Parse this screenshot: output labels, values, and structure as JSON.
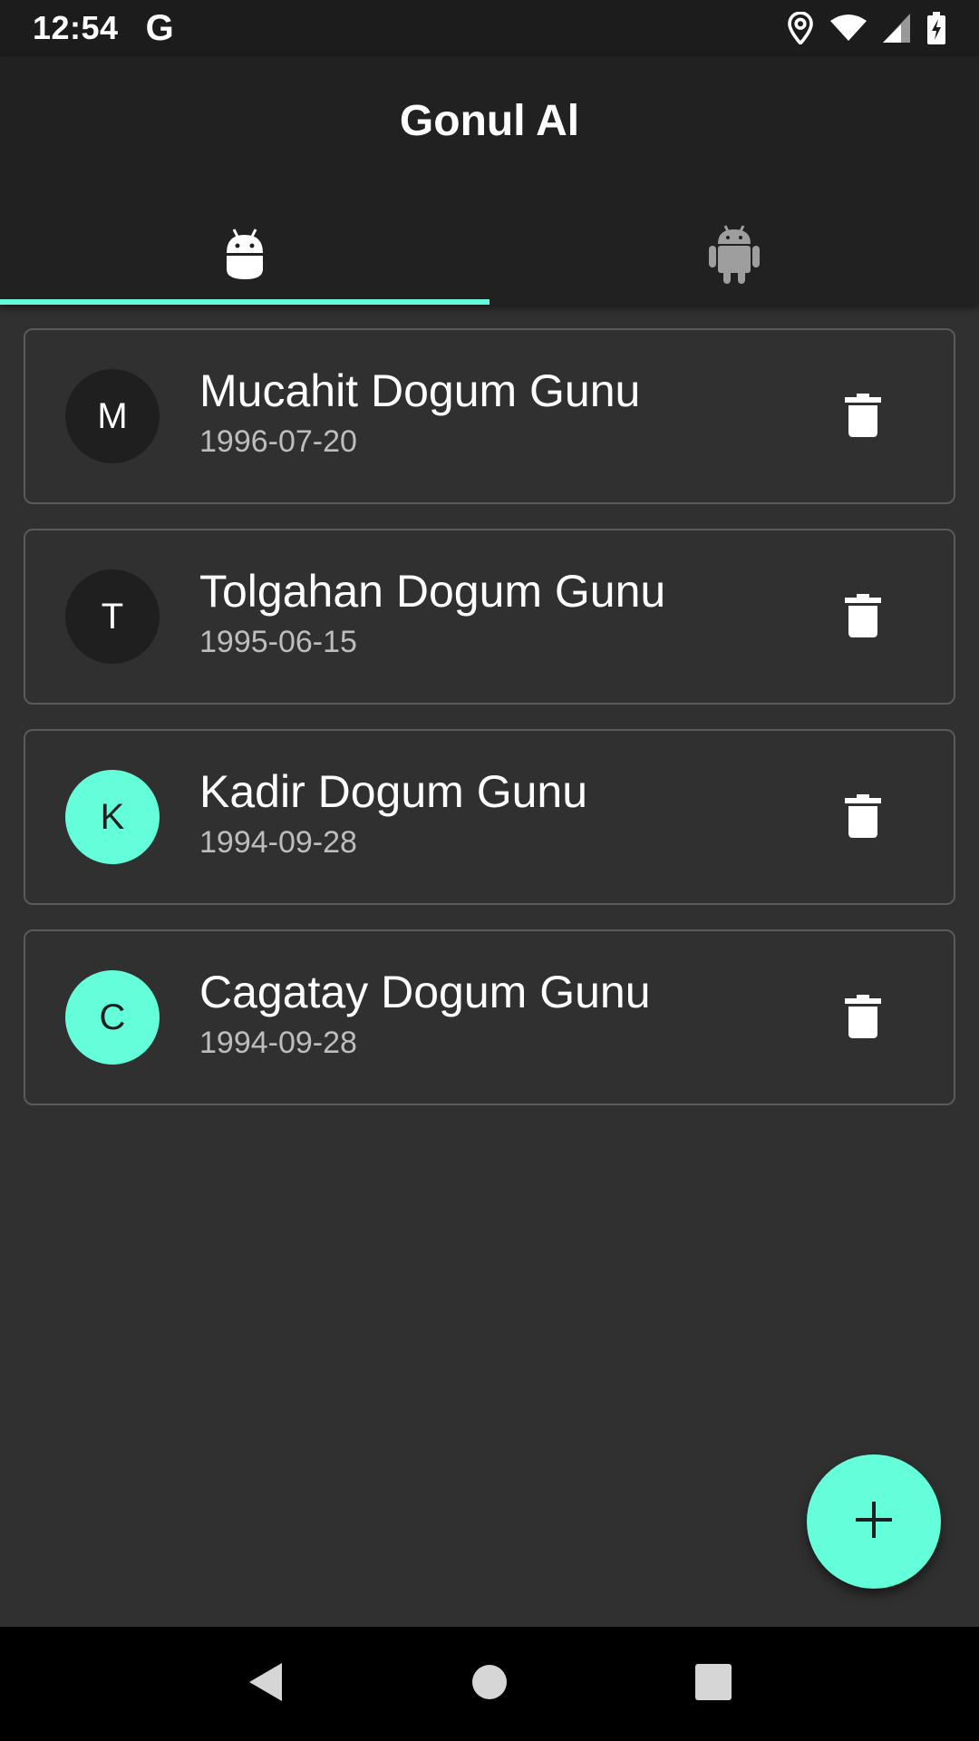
{
  "status_bar": {
    "time": "12:54",
    "google_glyph": "G",
    "icons": [
      "location-icon",
      "wifi-icon",
      "signal-icon",
      "battery-charging-icon"
    ]
  },
  "app_bar": {
    "title": "Gonul Al"
  },
  "tabs": [
    {
      "icon": "android-head-icon",
      "selected": true
    },
    {
      "icon": "android-robot-icon",
      "selected": false
    }
  ],
  "birthdays": [
    {
      "initial": "M",
      "title": "Mucahit Dogum Gunu",
      "date": "1996-07-20",
      "avatar_color": "#1f1f1f"
    },
    {
      "initial": "T",
      "title": "Tolgahan Dogum Gunu",
      "date": "1995-06-15",
      "avatar_color": "#1f1f1f"
    },
    {
      "initial": "K",
      "title": "Kadir Dogum Gunu",
      "date": "1994-09-28",
      "avatar_color": "#64ffda"
    },
    {
      "initial": "C",
      "title": "Cagatay Dogum Gunu",
      "date": "1994-09-28",
      "avatar_color": "#64ffda"
    }
  ],
  "fab": {
    "icon": "plus-icon"
  },
  "colors": {
    "accent": "#64ffda",
    "background": "#303030",
    "app_bar": "#212121"
  },
  "nav_bar": {
    "buttons": [
      "back-icon",
      "home-icon",
      "recents-icon"
    ]
  }
}
